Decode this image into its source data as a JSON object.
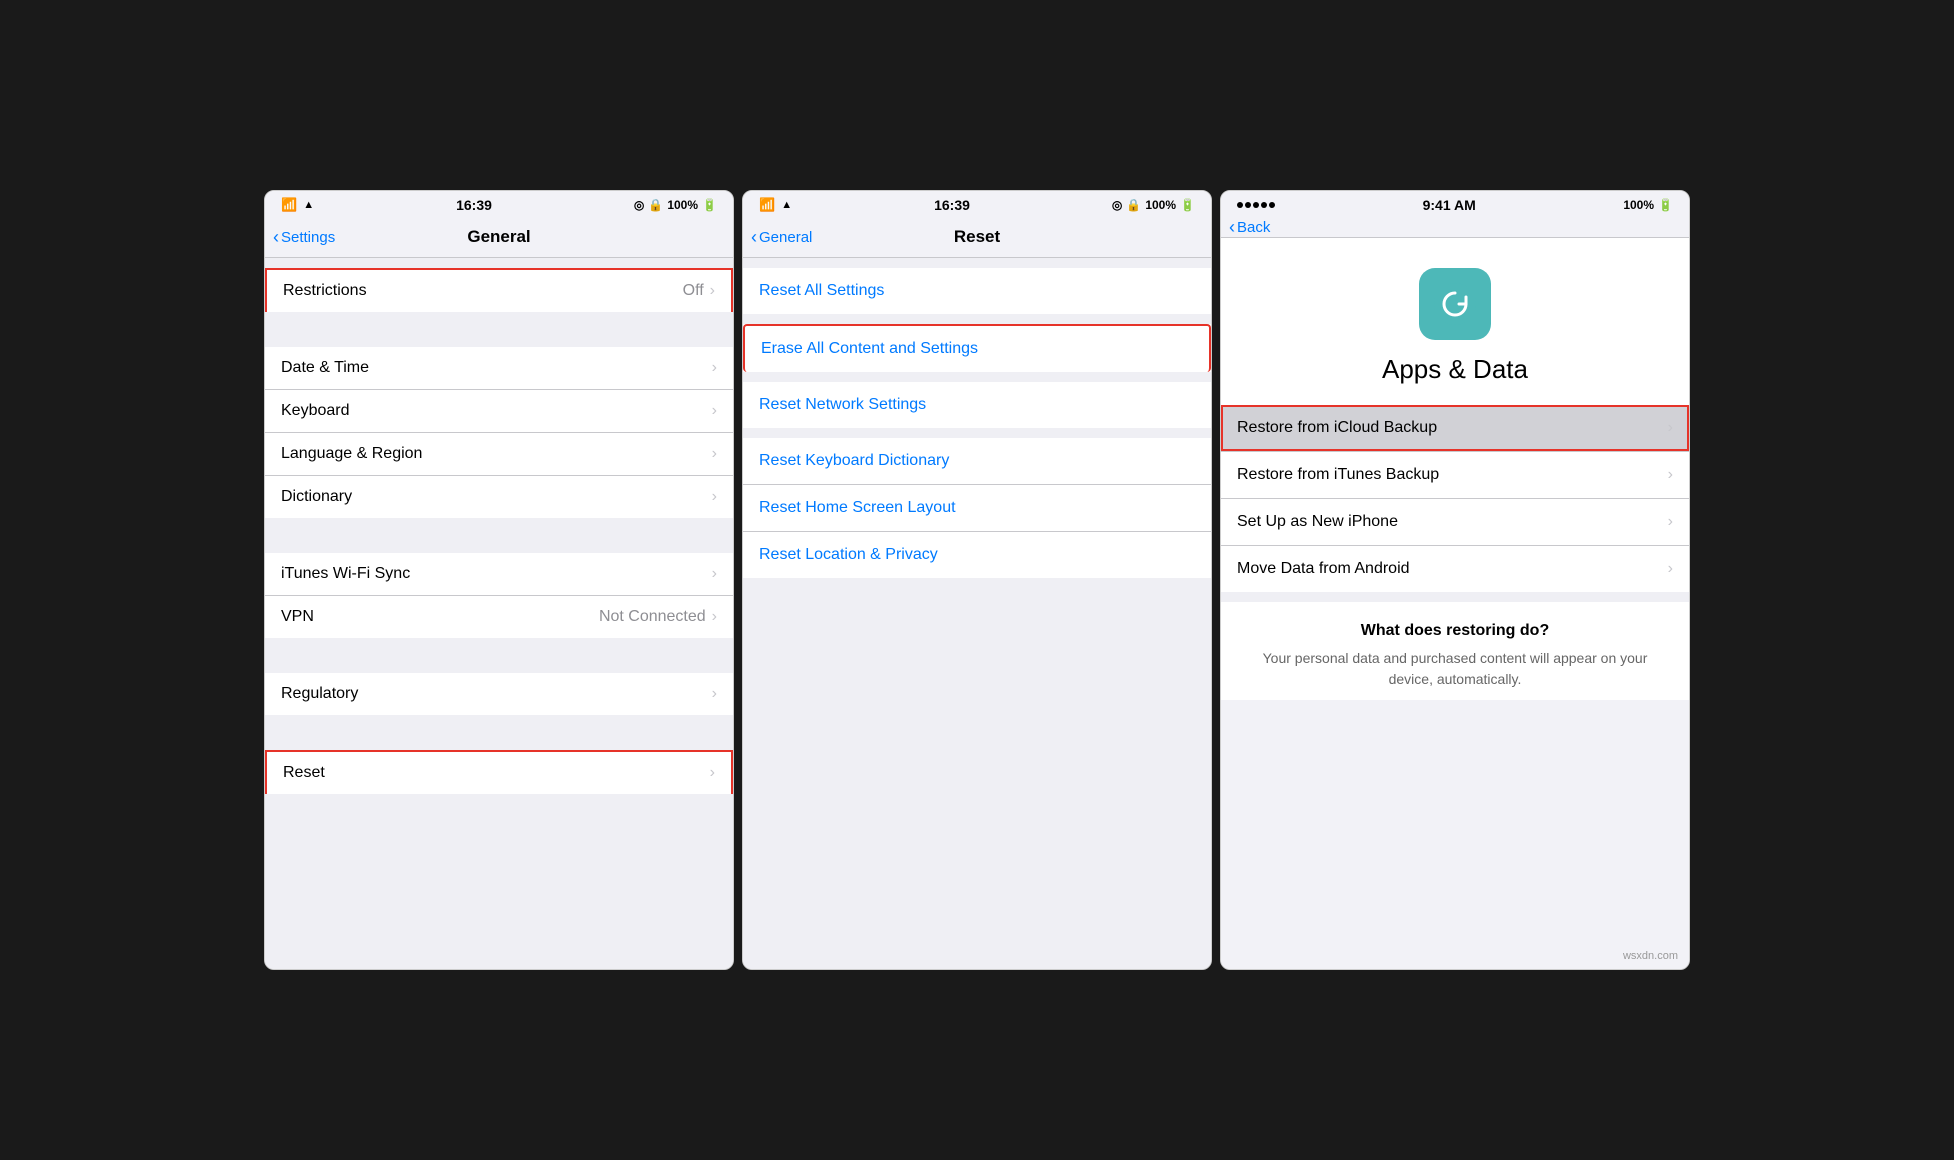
{
  "screen1": {
    "statusBar": {
      "time": "16:39",
      "wifiIcon": "wifi",
      "batteryPercent": "100%"
    },
    "navBar": {
      "backLabel": "Settings",
      "title": "General"
    },
    "items": [
      {
        "id": "restrictions",
        "label": "Restrictions",
        "value": "Off",
        "chevron": true,
        "highlighted": true
      },
      {
        "id": "date-time",
        "label": "Date & Time",
        "chevron": true
      },
      {
        "id": "keyboard",
        "label": "Keyboard",
        "chevron": true
      },
      {
        "id": "language-region",
        "label": "Language & Region",
        "chevron": true
      },
      {
        "id": "dictionary",
        "label": "Dictionary",
        "chevron": true
      },
      {
        "id": "itunes-wifi",
        "label": "iTunes Wi-Fi Sync",
        "chevron": true
      },
      {
        "id": "vpn",
        "label": "VPN",
        "value": "Not Connected",
        "chevron": true
      },
      {
        "id": "regulatory",
        "label": "Regulatory",
        "chevron": true
      },
      {
        "id": "reset",
        "label": "Reset",
        "chevron": true,
        "highlighted": true
      }
    ]
  },
  "screen2": {
    "statusBar": {
      "time": "16:39",
      "batteryPercent": "100%"
    },
    "navBar": {
      "backLabel": "General",
      "title": "Reset"
    },
    "items": [
      {
        "id": "reset-all",
        "label": "Reset All Settings",
        "highlighted": false
      },
      {
        "id": "erase-all",
        "label": "Erase All Content and Settings",
        "highlighted": true
      },
      {
        "id": "reset-network",
        "label": "Reset Network Settings",
        "highlighted": false
      },
      {
        "id": "reset-keyboard",
        "label": "Reset Keyboard Dictionary",
        "highlighted": false
      },
      {
        "id": "reset-home",
        "label": "Reset Home Screen Layout",
        "highlighted": false
      },
      {
        "id": "reset-location",
        "label": "Reset Location & Privacy",
        "highlighted": false
      }
    ]
  },
  "screen3": {
    "statusBar": {
      "dots": 5,
      "time": "9:41 AM",
      "batteryPercent": "100%"
    },
    "navBar": {
      "backLabel": "Back"
    },
    "icon": {
      "color": "#4db8b8",
      "semantic": "cloud-restore-icon"
    },
    "title": "Apps & Data",
    "items": [
      {
        "id": "restore-icloud",
        "label": "Restore from iCloud Backup",
        "chevron": true,
        "highlighted": true,
        "selected": true
      },
      {
        "id": "restore-itunes",
        "label": "Restore from iTunes Backup",
        "chevron": true
      },
      {
        "id": "setup-new",
        "label": "Set Up as New iPhone",
        "chevron": true
      },
      {
        "id": "move-android",
        "label": "Move Data from Android",
        "chevron": true
      }
    ],
    "whatDoes": {
      "title": "What does restoring do?",
      "text": "Your personal data and purchased content will appear on your device, automatically."
    }
  },
  "watermark": "wsxdn.com"
}
